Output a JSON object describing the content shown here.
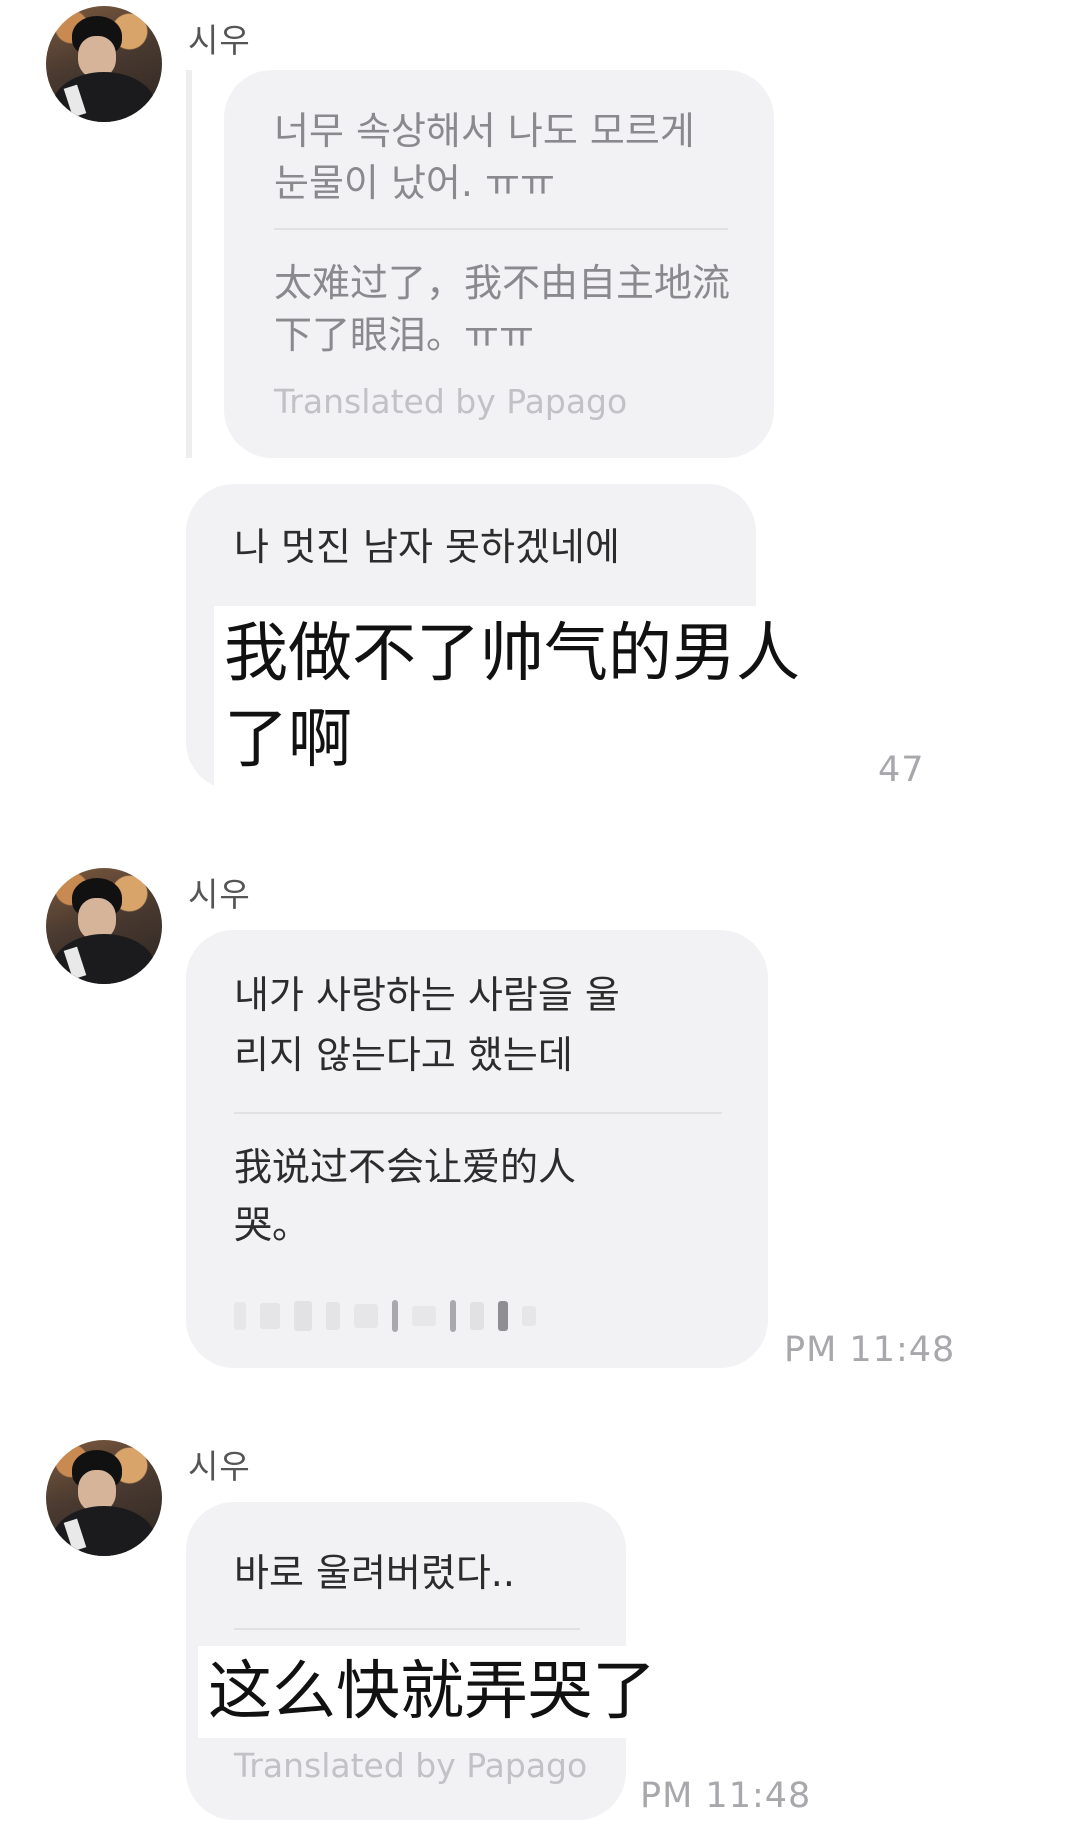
{
  "messages": [
    {
      "sender": "시우",
      "quoted": {
        "original": "너무 속상해서 나도 모르게 눈물이 났어. ㅠㅠ",
        "original_lines": [
          "너무 속상해서 나도 모르게",
          "눈물이 났어. ㅠㅠ"
        ],
        "translation_lines": [
          "太难过了，我不由自主地流",
          "下了眼泪。ㅠㅠ"
        ],
        "credit": "Translated by Papago"
      },
      "text": "나 멋진 남자 못하겠네에",
      "caption_lines": [
        "我做不了帅气的男人",
        "了啊"
      ],
      "time": "47"
    },
    {
      "sender": "시우",
      "text_lines": [
        "내가 사랑하는 사람을 울",
        "리지 않는다고 했는데"
      ],
      "translation_lines": [
        "我说过不会让爱的人",
        "哭。"
      ],
      "time": "PM 11:48"
    },
    {
      "sender": "시우",
      "text": "바로 울려버렸다..",
      "caption": "这么快就弄哭了",
      "credit": "Translated by Papago",
      "time": "PM 11:48"
    }
  ],
  "icons": {
    "avatar": "profile-photo-avatar"
  },
  "colors": {
    "bubble": "#f2f2f4",
    "time": "#a8a8ac",
    "credit": "#c2c2c6"
  }
}
